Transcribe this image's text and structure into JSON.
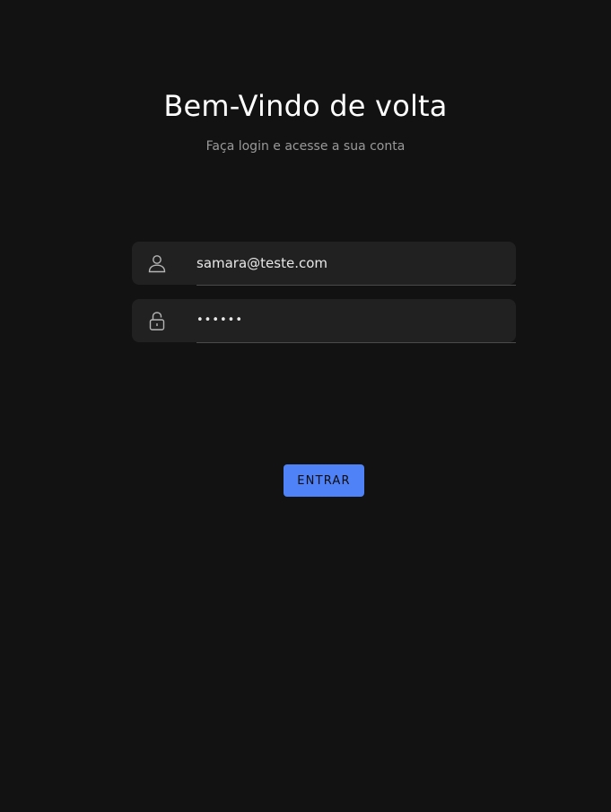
{
  "header": {
    "title": "Bem-Vindo de volta",
    "subtitle": "Faça login e acesse a sua conta"
  },
  "form": {
    "email": {
      "value": "samara@teste.com",
      "icon": "user-icon"
    },
    "password": {
      "value": "123456",
      "icon": "lock-icon"
    },
    "submit_label": "ENTRAR"
  },
  "colors": {
    "background": "#121212",
    "field_background": "#212121",
    "accent": "#4f82f7"
  }
}
